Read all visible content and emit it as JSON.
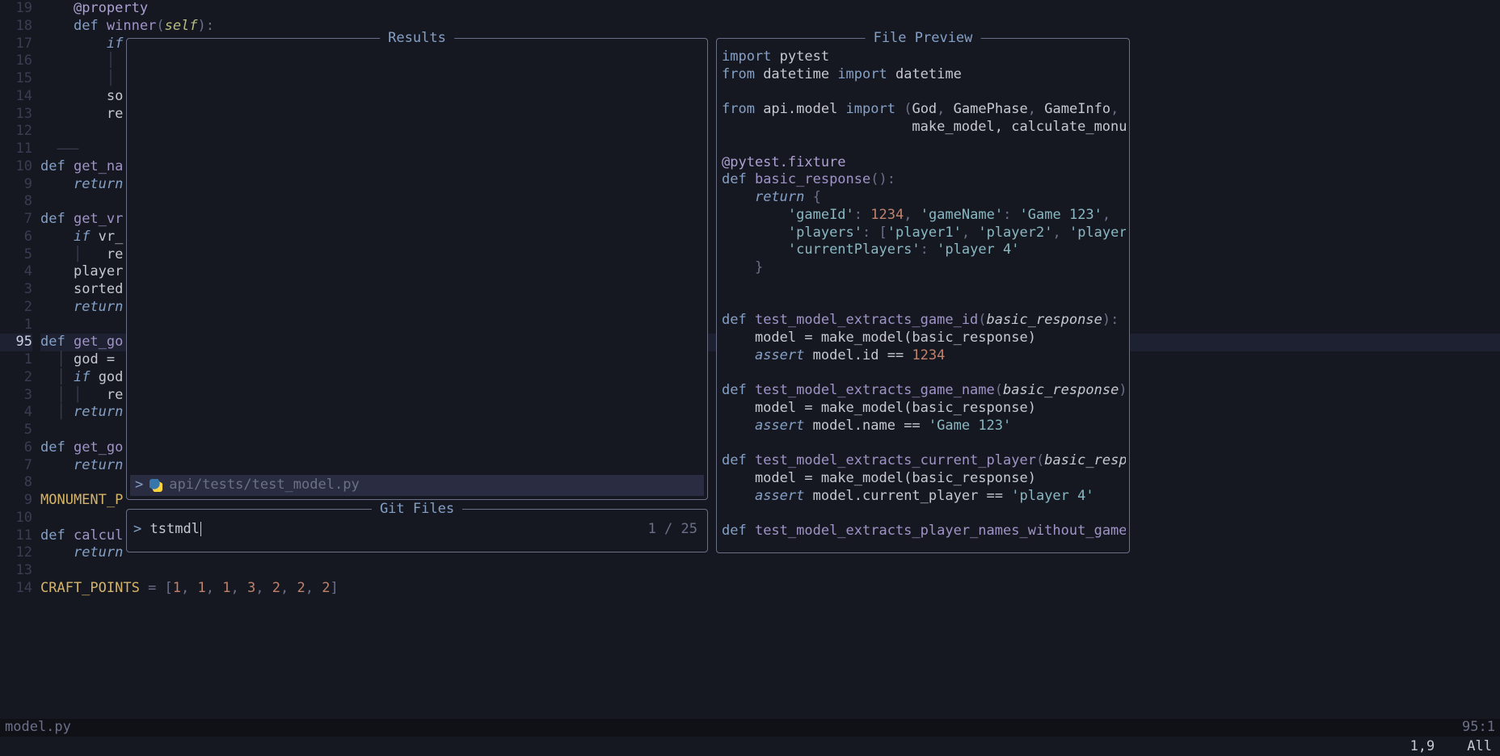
{
  "gutter": [
    "19",
    "18",
    "17",
    "16",
    "15",
    "14",
    "13",
    "12",
    "11",
    "10",
    "9",
    "8",
    "7",
    "6",
    "5",
    "4",
    "3",
    "2",
    "1",
    "95",
    "1",
    "2",
    "3",
    "4",
    "5",
    "6",
    "7",
    "8",
    "9",
    "10",
    "11",
    "12",
    "13",
    "14"
  ],
  "current_line_index": 19,
  "code_lines": [
    {
      "indent": "    ",
      "tokens": [
        {
          "t": "@property",
          "c": "decor"
        }
      ]
    },
    {
      "indent": "    ",
      "tokens": [
        {
          "t": "def ",
          "c": "kw"
        },
        {
          "t": "winner",
          "c": "fn"
        },
        {
          "t": "(",
          "c": "punc"
        },
        {
          "t": "self",
          "c": "self"
        },
        {
          "t": "):",
          "c": "punc"
        }
      ]
    },
    {
      "indent": "        ",
      "tokens": [
        {
          "t": "if",
          "c": "kw2"
        }
      ]
    },
    {
      "indent": "        ",
      "tokens": [
        {
          "t": "│",
          "c": "vbar"
        }
      ]
    },
    {
      "indent": "        ",
      "tokens": [
        {
          "t": "│",
          "c": "vbar"
        }
      ]
    },
    {
      "indent": "        ",
      "tokens": [
        {
          "t": "so",
          "c": "ident"
        }
      ]
    },
    {
      "indent": "        ",
      "tokens": [
        {
          "t": "re",
          "c": "ident"
        }
      ]
    },
    {
      "indent": "",
      "tokens": []
    },
    {
      "indent": "  ",
      "tokens": [
        {
          "t": "———",
          "c": "fold-marker"
        }
      ]
    },
    {
      "indent": "",
      "tokens": [
        {
          "t": "def ",
          "c": "kw"
        },
        {
          "t": "get_na",
          "c": "fn"
        }
      ]
    },
    {
      "indent": "    ",
      "tokens": [
        {
          "t": "return",
          "c": "kw2"
        }
      ]
    },
    {
      "indent": "",
      "tokens": []
    },
    {
      "indent": "",
      "tokens": [
        {
          "t": "def ",
          "c": "kw"
        },
        {
          "t": "get_vr",
          "c": "fn"
        }
      ]
    },
    {
      "indent": "    ",
      "tokens": [
        {
          "t": "if ",
          "c": "kw2"
        },
        {
          "t": "vr_",
          "c": "ident"
        }
      ]
    },
    {
      "indent": "    ",
      "tokens": [
        {
          "t": "│   ",
          "c": "vbar"
        },
        {
          "t": "re",
          "c": "ident"
        }
      ]
    },
    {
      "indent": "    ",
      "tokens": [
        {
          "t": "player",
          "c": "ident"
        }
      ]
    },
    {
      "indent": "    ",
      "tokens": [
        {
          "t": "sorted",
          "c": "ident"
        }
      ]
    },
    {
      "indent": "    ",
      "tokens": [
        {
          "t": "return",
          "c": "kw2"
        }
      ]
    },
    {
      "indent": "",
      "tokens": []
    },
    {
      "indent": "",
      "tokens": [
        {
          "t": "def ",
          "c": "kw"
        },
        {
          "t": "get_go",
          "c": "fn"
        }
      ],
      "current": true
    },
    {
      "indent": "  ",
      "tokens": [
        {
          "t": "│ ",
          "c": "vbar"
        },
        {
          "t": "god =",
          "c": "ident"
        }
      ]
    },
    {
      "indent": "  ",
      "tokens": [
        {
          "t": "│ ",
          "c": "vbar"
        },
        {
          "t": "if ",
          "c": "kw2"
        },
        {
          "t": "god",
          "c": "ident"
        }
      ]
    },
    {
      "indent": "  ",
      "tokens": [
        {
          "t": "│ │   ",
          "c": "vbar"
        },
        {
          "t": "re",
          "c": "ident"
        }
      ]
    },
    {
      "indent": "  ",
      "tokens": [
        {
          "t": "│ ",
          "c": "vbar"
        },
        {
          "t": "return",
          "c": "kw2"
        }
      ]
    },
    {
      "indent": "",
      "tokens": []
    },
    {
      "indent": "",
      "tokens": [
        {
          "t": "def ",
          "c": "kw"
        },
        {
          "t": "get_go",
          "c": "fn"
        }
      ]
    },
    {
      "indent": "    ",
      "tokens": [
        {
          "t": "return",
          "c": "kw2"
        }
      ]
    },
    {
      "indent": "",
      "tokens": []
    },
    {
      "indent": "",
      "tokens": [
        {
          "t": "MONUMENT_P",
          "c": "const"
        }
      ]
    },
    {
      "indent": "",
      "tokens": []
    },
    {
      "indent": "",
      "tokens": [
        {
          "t": "def ",
          "c": "kw"
        },
        {
          "t": "calcul",
          "c": "fn"
        }
      ]
    },
    {
      "indent": "    ",
      "tokens": [
        {
          "t": "return",
          "c": "kw2"
        }
      ]
    },
    {
      "indent": "",
      "tokens": []
    },
    {
      "indent": "",
      "tokens": [
        {
          "t": "CRAFT_POINTS",
          "c": "const"
        },
        {
          "t": " = [",
          "c": "punc"
        },
        {
          "t": "1",
          "c": "num"
        },
        {
          "t": ", ",
          "c": "punc"
        },
        {
          "t": "1",
          "c": "num"
        },
        {
          "t": ", ",
          "c": "punc"
        },
        {
          "t": "1",
          "c": "num"
        },
        {
          "t": ", ",
          "c": "punc"
        },
        {
          "t": "3",
          "c": "num"
        },
        {
          "t": ", ",
          "c": "punc"
        },
        {
          "t": "2",
          "c": "num"
        },
        {
          "t": ", ",
          "c": "punc"
        },
        {
          "t": "2",
          "c": "num"
        },
        {
          "t": ", ",
          "c": "punc"
        },
        {
          "t": "2",
          "c": "num"
        },
        {
          "t": "]",
          "c": "punc"
        }
      ]
    }
  ],
  "results": {
    "title": "Results",
    "selected": {
      "chevron": ">",
      "path_dim": "api/tests/",
      "path_match": "test_model",
      "path_ext": ".py"
    }
  },
  "gitfiles": {
    "title": "Git Files",
    "prompt": ">",
    "query": "tstmdl",
    "count": "1 / 25"
  },
  "preview": {
    "title": "File Preview",
    "lines": [
      [
        {
          "t": "import ",
          "c": "kw"
        },
        {
          "t": "pytest",
          "c": "ident"
        }
      ],
      [
        {
          "t": "from ",
          "c": "kw"
        },
        {
          "t": "datetime ",
          "c": "ident"
        },
        {
          "t": "import ",
          "c": "kw"
        },
        {
          "t": "datetime",
          "c": "ident"
        }
      ],
      [],
      [
        {
          "t": "from ",
          "c": "kw"
        },
        {
          "t": "api.model ",
          "c": "ident"
        },
        {
          "t": "import ",
          "c": "kw"
        },
        {
          "t": "(",
          "c": "punc"
        },
        {
          "t": "God",
          "c": "ident"
        },
        {
          "t": ", ",
          "c": "punc"
        },
        {
          "t": "GamePhase",
          "c": "ident"
        },
        {
          "t": ", ",
          "c": "punc"
        },
        {
          "t": "GameInfo",
          "c": "ident"
        },
        {
          "t": ",",
          "c": "punc"
        }
      ],
      [
        {
          "t": "                       make_model, calculate_monu",
          "c": "ident"
        }
      ],
      [],
      [
        {
          "t": "@pytest.fixture",
          "c": "decor"
        }
      ],
      [
        {
          "t": "def ",
          "c": "kw"
        },
        {
          "t": "basic_response",
          "c": "fn"
        },
        {
          "t": "():",
          "c": "punc"
        }
      ],
      [
        {
          "t": "    ",
          "c": ""
        },
        {
          "t": "return ",
          "c": "kw2"
        },
        {
          "t": "{",
          "c": "punc"
        }
      ],
      [
        {
          "t": "        ",
          "c": ""
        },
        {
          "t": "'gameId'",
          "c": "str"
        },
        {
          "t": ": ",
          "c": "punc"
        },
        {
          "t": "1234",
          "c": "num"
        },
        {
          "t": ", ",
          "c": "punc"
        },
        {
          "t": "'gameName'",
          "c": "str"
        },
        {
          "t": ": ",
          "c": "punc"
        },
        {
          "t": "'Game 123'",
          "c": "str"
        },
        {
          "t": ",",
          "c": "punc"
        }
      ],
      [
        {
          "t": "        ",
          "c": ""
        },
        {
          "t": "'players'",
          "c": "str"
        },
        {
          "t": ": [",
          "c": "punc"
        },
        {
          "t": "'player1'",
          "c": "str"
        },
        {
          "t": ", ",
          "c": "punc"
        },
        {
          "t": "'player2'",
          "c": "str"
        },
        {
          "t": ", ",
          "c": "punc"
        },
        {
          "t": "'player",
          "c": "str"
        }
      ],
      [
        {
          "t": "        ",
          "c": ""
        },
        {
          "t": "'currentPlayers'",
          "c": "str"
        },
        {
          "t": ": ",
          "c": "punc"
        },
        {
          "t": "'player 4'",
          "c": "str"
        }
      ],
      [
        {
          "t": "    }",
          "c": "punc"
        }
      ],
      [],
      [],
      [
        {
          "t": "def ",
          "c": "kw"
        },
        {
          "t": "test_model_extracts_game_id",
          "c": "fn"
        },
        {
          "t": "(",
          "c": "punc"
        },
        {
          "t": "basic_response",
          "c": "param"
        },
        {
          "t": "):",
          "c": "punc"
        }
      ],
      [
        {
          "t": "    model = make_model(basic_response)",
          "c": "ident"
        }
      ],
      [
        {
          "t": "    ",
          "c": ""
        },
        {
          "t": "assert ",
          "c": "kw2"
        },
        {
          "t": "model.id == ",
          "c": "ident"
        },
        {
          "t": "1234",
          "c": "num"
        }
      ],
      [],
      [
        {
          "t": "def ",
          "c": "kw"
        },
        {
          "t": "test_model_extracts_game_name",
          "c": "fn"
        },
        {
          "t": "(",
          "c": "punc"
        },
        {
          "t": "basic_response",
          "c": "param"
        },
        {
          "t": ")",
          "c": "punc"
        }
      ],
      [
        {
          "t": "    model = make_model(basic_response)",
          "c": "ident"
        }
      ],
      [
        {
          "t": "    ",
          "c": ""
        },
        {
          "t": "assert ",
          "c": "kw2"
        },
        {
          "t": "model.name == ",
          "c": "ident"
        },
        {
          "t": "'Game 123'",
          "c": "str"
        }
      ],
      [],
      [
        {
          "t": "def ",
          "c": "kw"
        },
        {
          "t": "test_model_extracts_current_player",
          "c": "fn"
        },
        {
          "t": "(",
          "c": "punc"
        },
        {
          "t": "basic_resp",
          "c": "param"
        }
      ],
      [
        {
          "t": "    model = make_model(basic_response)",
          "c": "ident"
        }
      ],
      [
        {
          "t": "    ",
          "c": ""
        },
        {
          "t": "assert ",
          "c": "kw2"
        },
        {
          "t": "model.current_player == ",
          "c": "ident"
        },
        {
          "t": "'player 4'",
          "c": "str"
        }
      ],
      [],
      [
        {
          "t": "def ",
          "c": "kw"
        },
        {
          "t": "test_model_extracts_player_names_without_game",
          "c": "fn"
        }
      ]
    ]
  },
  "statusbar": {
    "filename": "model.py",
    "pos": "95:1"
  },
  "ruler": {
    "cursor": "1,9",
    "scroll": "All"
  }
}
